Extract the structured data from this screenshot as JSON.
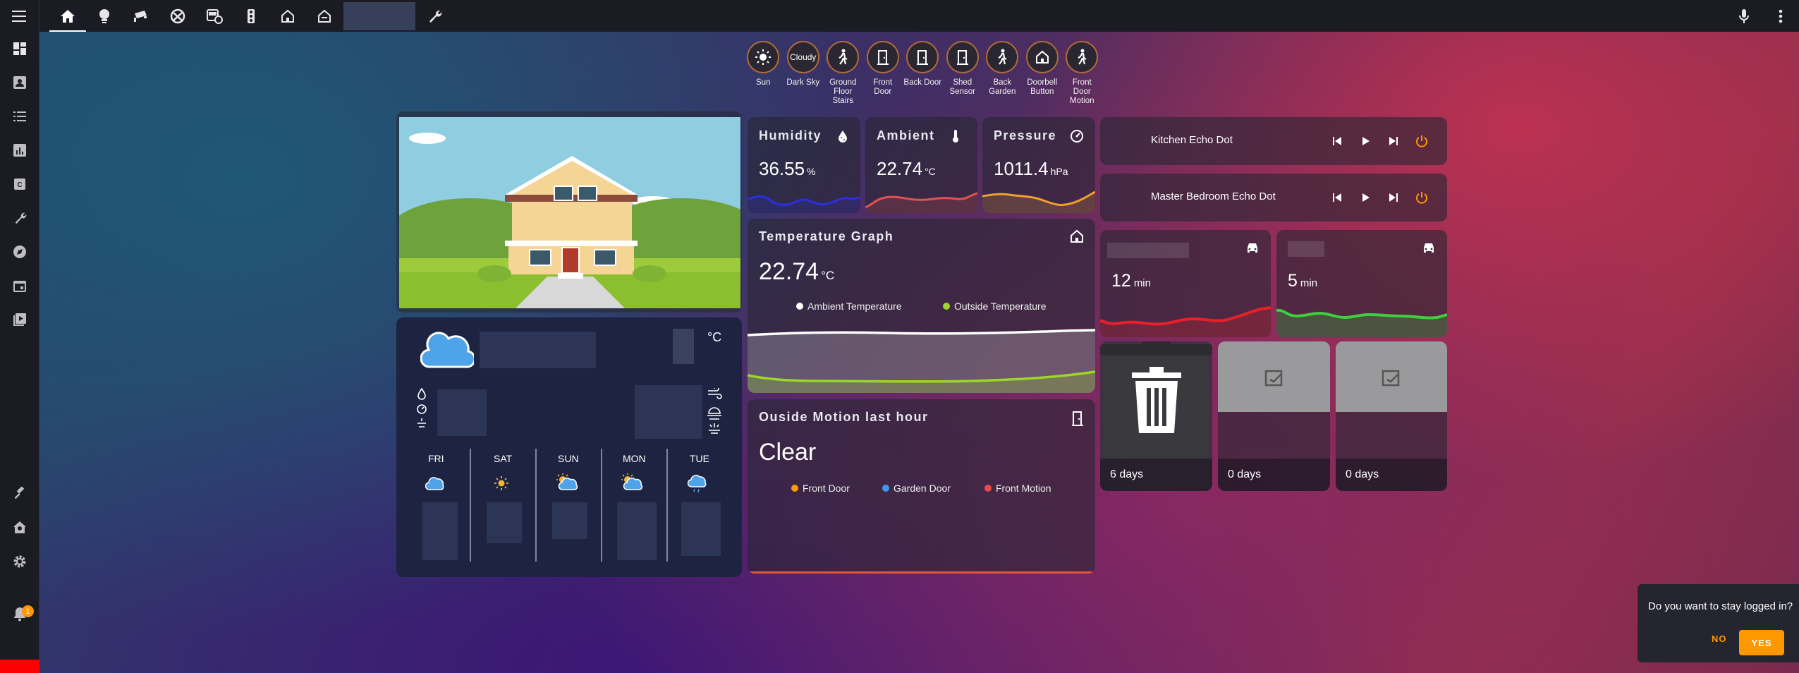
{
  "topbar": {
    "tabs": [
      "home",
      "lightbulb",
      "cctv",
      "xbox",
      "bus",
      "traffic-light",
      "home-outline",
      "home-alt",
      "blank",
      "wrench"
    ]
  },
  "sidebar": {
    "items": [
      "dashboard",
      "account-box",
      "logbook",
      "history",
      "hacs",
      "wrench",
      "compass",
      "calendar",
      "media"
    ],
    "bottom": [
      "hammer",
      "home-cog",
      "settings"
    ],
    "notifications": "1"
  },
  "badges": [
    {
      "label": "Sun",
      "icon": "sun-icon",
      "text": ""
    },
    {
      "label": "Dark Sky",
      "icon": "",
      "text": "Cloudy"
    },
    {
      "label": "Ground Floor Stairs",
      "icon": "walk-icon",
      "text": ""
    },
    {
      "label": "Front Door",
      "icon": "door-icon",
      "text": ""
    },
    {
      "label": "Back Door",
      "icon": "door-icon",
      "text": ""
    },
    {
      "label": "Shed Sensor",
      "icon": "door-icon",
      "text": ""
    },
    {
      "label": "Back Garden",
      "icon": "walk-icon",
      "text": ""
    },
    {
      "label": "Doorbell Button",
      "icon": "home-icon",
      "text": ""
    },
    {
      "label": "Front Door Motion",
      "icon": "walk-icon",
      "text": ""
    }
  ],
  "sensors": {
    "humidity": {
      "title": "Humidity",
      "value": "36.55",
      "unit": "%",
      "line_color": "#2d2ee0"
    },
    "ambient": {
      "title": "Ambient",
      "value": "22.74",
      "unit": "°C",
      "line_color": "#e0534f"
    },
    "pressure": {
      "title": "Pressure",
      "value": "1011.4",
      "unit": "hPa",
      "line_color": "#f0a030"
    }
  },
  "temperature_graph": {
    "title": "Temperature Graph",
    "value": "22.74",
    "unit": "°C",
    "legend": [
      {
        "name": "Ambient Temperature",
        "color": "#ffffff"
      },
      {
        "name": "Outside Temperature",
        "color": "#9cd62a"
      }
    ]
  },
  "motion": {
    "title": "Ouside Motion last hour",
    "state": "Clear",
    "legend": [
      {
        "name": "Front Door",
        "color": "#ff9800"
      },
      {
        "name": "Garden Door",
        "color": "#3d9ae8"
      },
      {
        "name": "Front Motion",
        "color": "#e84a4a"
      }
    ]
  },
  "weather": {
    "unit": "°C",
    "days": [
      "FRI",
      "SAT",
      "SUN",
      "MON",
      "TUE"
    ]
  },
  "media_players": [
    {
      "name": "Kitchen Echo Dot"
    },
    {
      "name": "Master Bedroom Echo Dot"
    }
  ],
  "travel": [
    {
      "value": "12",
      "unit": "min",
      "line_color": "#e8202a"
    },
    {
      "value": "5",
      "unit": "min",
      "line_color": "#3ecf3e"
    }
  ],
  "bins": [
    {
      "days": "6 days"
    },
    {
      "days": "0 days"
    },
    {
      "days": "0 days"
    }
  ],
  "toast": {
    "message": "Do you want to stay logged in?",
    "no_label": "NO",
    "yes_label": "YES"
  }
}
